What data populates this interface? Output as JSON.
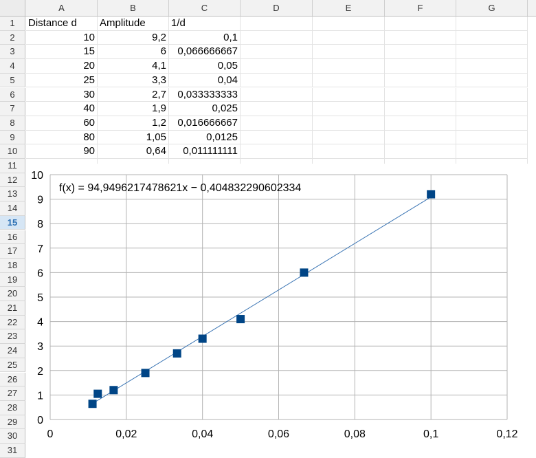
{
  "columns": [
    "A",
    "B",
    "C",
    "D",
    "E",
    "F",
    "G"
  ],
  "rows": [
    "1",
    "2",
    "3",
    "4",
    "5",
    "6",
    "7",
    "8",
    "9",
    "10",
    "11",
    "12",
    "13",
    "14",
    "15",
    "16",
    "17",
    "18",
    "19",
    "20",
    "21",
    "22",
    "23",
    "24",
    "25",
    "26",
    "27",
    "28",
    "29",
    "30",
    "31"
  ],
  "active_row": "15",
  "table": {
    "headers": [
      "Distance d",
      "Amplitude",
      "1/d"
    ],
    "data": [
      [
        "10",
        "9,2",
        "0,1"
      ],
      [
        "15",
        "6",
        "0,066666667"
      ],
      [
        "20",
        "4,1",
        "0,05"
      ],
      [
        "25",
        "3,3",
        "0,04"
      ],
      [
        "30",
        "2,7",
        "0,033333333"
      ],
      [
        "40",
        "1,9",
        "0,025"
      ],
      [
        "60",
        "1,2",
        "0,016666667"
      ],
      [
        "80",
        "1,05",
        "0,0125"
      ],
      [
        "90",
        "0,64",
        "0,011111111"
      ]
    ]
  },
  "chart_data": {
    "type": "scatter",
    "equation": "f(x) = 94,9496217478621x − 0,404832290602334",
    "x": [
      0.1,
      0.066666667,
      0.05,
      0.04,
      0.033333333,
      0.025,
      0.016666667,
      0.0125,
      0.011111111
    ],
    "y": [
      9.2,
      6,
      4.1,
      3.3,
      2.7,
      1.9,
      1.2,
      1.05,
      0.64
    ],
    "trendline": {
      "slope": 94.9496217478621,
      "intercept": -0.404832290602334,
      "x_range": [
        0.011111111,
        0.1
      ]
    },
    "xlim": [
      0,
      0.12
    ],
    "ylim": [
      0,
      10
    ],
    "xticks": [
      "0",
      "0,02",
      "0,04",
      "0,06",
      "0,08",
      "0,1",
      "0,12"
    ],
    "yticks": [
      "0",
      "1",
      "2",
      "3",
      "4",
      "5",
      "6",
      "7",
      "8",
      "9",
      "10"
    ],
    "grid": true,
    "marker_color": "#004586",
    "line_color": "#3873b3"
  }
}
